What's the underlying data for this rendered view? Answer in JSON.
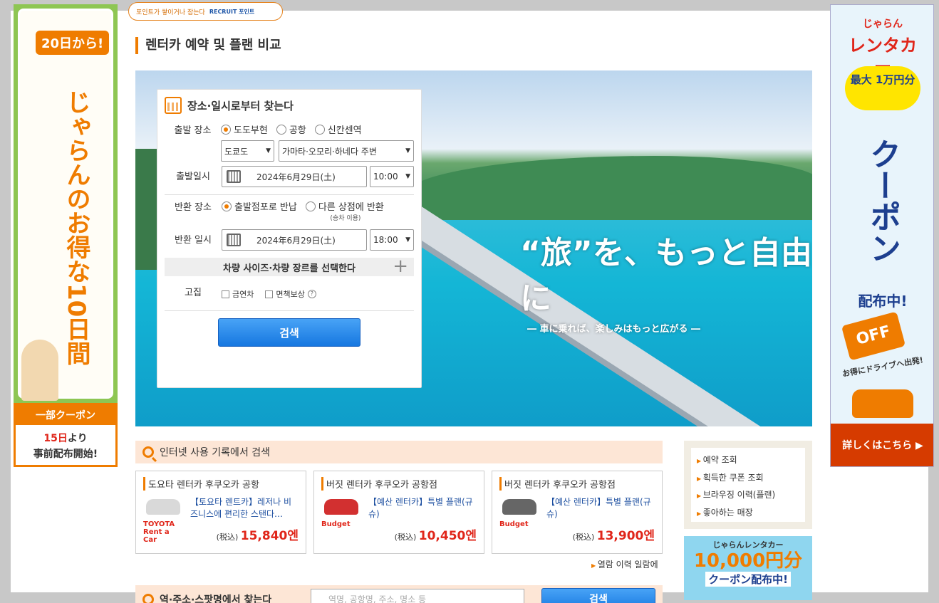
{
  "points_badge": {
    "text": "포인트가 쌓이거나 잠는다",
    "brand": "RECRUIT 포인트"
  },
  "page_title": "렌터카 예약 및 플랜 비교",
  "left_ad": {
    "tag": "20日から!",
    "vertical_text": "じゃらんのお得な10日間",
    "bottom_line1": "一部クーポン",
    "bottom_line2a": "15日",
    "bottom_line2b": "より",
    "bottom_line3": "事前配布開始!"
  },
  "right_ad": {
    "logo_small": "じゃらん",
    "logo": "レンタカー",
    "cloud": "最大 1万円分",
    "vertical_text": "クーポン",
    "dist": "配布中!",
    "off": "OFF",
    "drive": "お得にドライブへ出発!",
    "more": "詳しくはこちら ▶"
  },
  "hero": {
    "catch_big": "“旅”を、もっと自由に",
    "catch_sub": "― 車に乗れば、楽しみはもっと広がる ―"
  },
  "search": {
    "heading": "장소·일시로부터 찾는다",
    "departure_label": "출발 장소",
    "dep_options": [
      "도도부현",
      "공항",
      "신칸센역"
    ],
    "prefecture": "도쿄도",
    "area": "가마타·오모리·하네다 주변",
    "datetime_label": "출발일시",
    "dep_date": "2024年6月29日(土)",
    "dep_time": "10:00",
    "return_label": "반환 장소",
    "ret_options": [
      "출발점포로 반납",
      "다른 상점에 반환"
    ],
    "ret_note": "(승차 이용)",
    "return_dt_label": "반환 일시",
    "ret_date": "2024年6月29日(土)",
    "ret_time": "18:00",
    "vehicle_bar": "차량 사이즈·차량 장르를 선택한다",
    "particular_label": "고집",
    "check_nonsmoking": "금연차",
    "check_insurance": "면책보상",
    "help": "?",
    "button": "검색"
  },
  "history": {
    "heading": "인터넷 사용 기록에서 검색",
    "cards": [
      {
        "title": "도요타 렌터카 후쿠오카 공항",
        "plan": "【토요타 렌트카】레저나 비즈니스에 편리한 스탠다…",
        "brand": "TOYOTA Rent a Car",
        "tax": "(税込)",
        "price": "15,840엔",
        "car_color": "#d9d9d9",
        "brand_color": "#e0261a"
      },
      {
        "title": "버짓 렌터카 후쿠오카 공항점",
        "plan": "【예산 렌터카】특별 플랜(규슈)",
        "brand": "Budget",
        "tax": "(税込)",
        "price": "10,450엔",
        "car_color": "#d23030",
        "brand_color": "#e0261a"
      },
      {
        "title": "버짓 렌터카 후쿠오카 공항점",
        "plan": "【예산 렌터카】특별 플랜(규슈)",
        "brand": "Budget",
        "tax": "(税込)",
        "price": "13,900엔",
        "car_color": "#666666",
        "brand_color": "#e0261a"
      }
    ],
    "link": "열람 이력 일람에"
  },
  "side_menu": [
    "예약 조회",
    "획득한 쿠폰 조회",
    "브라우징 이력(플랜)",
    "좋아하는 매장"
  ],
  "side_banner": {
    "t1": "じゃらんレンタカー",
    "t2": "10,000円分",
    "t3": "クーポン配布中!"
  },
  "bottom_search": {
    "label": "역·주소·스팟명에서 찾는다",
    "placeholder": "역명, 공항명, 주소, 명소 등",
    "button": "검색"
  }
}
